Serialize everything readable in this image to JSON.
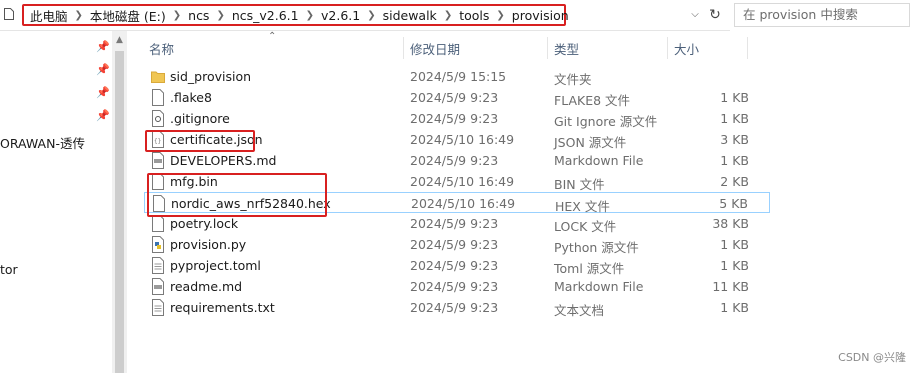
{
  "address": {
    "crumbs": [
      "此电脑",
      "本地磁盘 (E:)",
      "ncs",
      "ncs_v2.6.1",
      "v2.6.1",
      "sidewalk",
      "tools",
      "provision"
    ],
    "search_placeholder": "在 provision 中搜索"
  },
  "nav": {
    "items": [
      "ORAWAN-透传",
      "tor"
    ]
  },
  "columns": {
    "name": "名称",
    "date": "修改日期",
    "type": "类型",
    "size": "大小"
  },
  "files": [
    {
      "name": "sid_provision",
      "date": "2024/5/9 15:15",
      "type": "文件夹",
      "size": "",
      "icon": "folder-icon"
    },
    {
      "name": ".flake8",
      "date": "2024/5/9 9:23",
      "type": "FLAKE8 文件",
      "size": "1 KB",
      "icon": "file-icon"
    },
    {
      "name": ".gitignore",
      "date": "2024/5/9 9:23",
      "type": "Git Ignore 源文件",
      "size": "1 KB",
      "icon": "gear-file-icon"
    },
    {
      "name": "certificate.json",
      "date": "2024/5/10 16:49",
      "type": "JSON 源文件",
      "size": "3 KB",
      "icon": "json-file-icon"
    },
    {
      "name": "DEVELOPERS.md",
      "date": "2024/5/9 9:23",
      "type": "Markdown File",
      "size": "1 KB",
      "icon": "markdown-file-icon"
    },
    {
      "name": "mfg.bin",
      "date": "2024/5/10 16:49",
      "type": "BIN 文件",
      "size": "2 KB",
      "icon": "file-icon"
    },
    {
      "name": "nordic_aws_nrf52840.hex",
      "date": "2024/5/10 16:49",
      "type": "HEX 文件",
      "size": "5 KB",
      "icon": "file-icon"
    },
    {
      "name": "poetry.lock",
      "date": "2024/5/9 9:23",
      "type": "LOCK 文件",
      "size": "38 KB",
      "icon": "file-icon"
    },
    {
      "name": "provision.py",
      "date": "2024/5/9 9:23",
      "type": "Python 源文件",
      "size": "1 KB",
      "icon": "python-file-icon"
    },
    {
      "name": "pyproject.toml",
      "date": "2024/5/9 9:23",
      "type": "Toml 源文件",
      "size": "1 KB",
      "icon": "text-file-icon"
    },
    {
      "name": "readme.md",
      "date": "2024/5/9 9:23",
      "type": "Markdown File",
      "size": "11 KB",
      "icon": "markdown-file-icon"
    },
    {
      "name": "requirements.txt",
      "date": "2024/5/9 9:23",
      "type": "文本文档",
      "size": "1 KB",
      "icon": "text-file-icon"
    }
  ],
  "watermark": "CSDN @兴隆",
  "colors": {
    "highlight": "#d82020",
    "selection_border": "#99d1ff",
    "folder": "#f0c654"
  }
}
